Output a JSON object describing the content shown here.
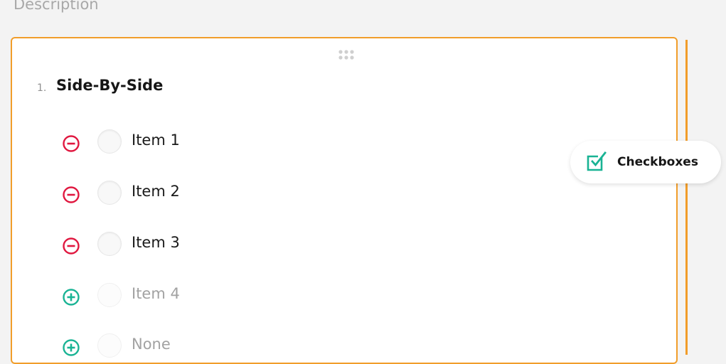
{
  "header": {
    "description_label": "Description"
  },
  "question": {
    "number": "1.",
    "title": "Side-By-Side",
    "choices": [
      {
        "label": "Item 1",
        "action": "remove",
        "enabled": true
      },
      {
        "label": "Item 2",
        "action": "remove",
        "enabled": true
      },
      {
        "label": "Item 3",
        "action": "remove",
        "enabled": true
      },
      {
        "label": "Item 4",
        "action": "add",
        "enabled": false
      },
      {
        "label": "None",
        "action": "add",
        "enabled": false
      }
    ]
  },
  "question_type": {
    "label": "Checkboxes",
    "icon": "checkbox-checked-icon"
  },
  "colors": {
    "accent": "#f19d2a",
    "remove": "#e0173f",
    "add": "#19b394",
    "checkbox_icon": "#19b394"
  }
}
